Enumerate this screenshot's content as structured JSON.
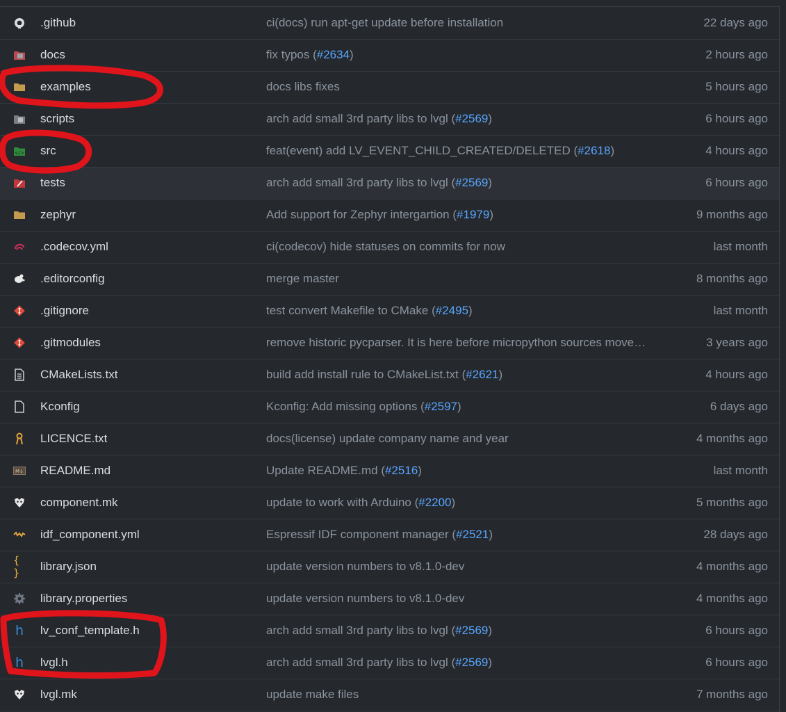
{
  "files": [
    {
      "name": ".github",
      "icon": "github-folder-icon",
      "commit": "ci(docs) run apt-get update before installation",
      "pr": "",
      "age": "22 days ago"
    },
    {
      "name": "docs",
      "icon": "docs-folder-icon",
      "commit": "fix typos (",
      "pr": "#2634",
      "commit_end": ")",
      "age": "2 hours ago"
    },
    {
      "name": "examples",
      "icon": "folder-icon",
      "commit": "docs libs fixes",
      "pr": "",
      "age": "5 hours ago"
    },
    {
      "name": "scripts",
      "icon": "scripts-folder-icon",
      "commit": "arch add small 3rd party libs to lvgl (",
      "pr": "#2569",
      "commit_end": ")",
      "age": "6 hours ago"
    },
    {
      "name": "src",
      "icon": "src-folder-icon",
      "commit": "feat(event) add LV_EVENT_CHILD_CREATED/DELETED (",
      "pr": "#2618",
      "commit_end": ")",
      "age": "4 hours ago"
    },
    {
      "name": "tests",
      "icon": "test-folder-icon",
      "commit": "arch add small 3rd party libs to lvgl (",
      "pr": "#2569",
      "commit_end": ")",
      "age": "6 hours ago"
    },
    {
      "name": "zephyr",
      "icon": "folder-icon",
      "commit": "Add support for Zephyr intergartion (",
      "pr": "#1979",
      "commit_end": ")",
      "age": "9 months ago"
    },
    {
      "name": ".codecov.yml",
      "icon": "codecov-icon",
      "commit": "ci(codecov) hide statuses on commits for now",
      "pr": "",
      "age": "last month"
    },
    {
      "name": ".editorconfig",
      "icon": "editorconfig-icon",
      "commit": "merge master",
      "pr": "",
      "age": "8 months ago"
    },
    {
      "name": ".gitignore",
      "icon": "git-icon",
      "commit": "test convert Makefile to CMake (",
      "pr": "#2495",
      "commit_end": ")",
      "age": "last month"
    },
    {
      "name": ".gitmodules",
      "icon": "git-icon",
      "commit": "remove historic pycparser. It is here before micropython sources move…",
      "pr": "",
      "age": "3 years ago"
    },
    {
      "name": "CMakeLists.txt",
      "icon": "text-file-icon",
      "commit": "build add install rule to CMakeList.txt (",
      "pr": "#2621",
      "commit_end": ")",
      "age": "4 hours ago"
    },
    {
      "name": "Kconfig",
      "icon": "file-icon",
      "commit": "Kconfig: Add missing options (",
      "pr": "#2597",
      "commit_end": ")",
      "age": "6 days ago"
    },
    {
      "name": "LICENCE.txt",
      "icon": "license-icon",
      "commit": "docs(license) update company name and year",
      "pr": "",
      "age": "4 months ago"
    },
    {
      "name": "README.md",
      "icon": "markdown-icon",
      "commit": "Update README.md (",
      "pr": "#2516",
      "commit_end": ")",
      "age": "last month"
    },
    {
      "name": "component.mk",
      "icon": "makefile-icon",
      "commit": "update to work with Arduino (",
      "pr": "#2200",
      "commit_end": ")",
      "age": "5 months ago"
    },
    {
      "name": "idf_component.yml",
      "icon": "yaml-icon",
      "commit": "Espressif IDF component manager (",
      "pr": "#2521",
      "commit_end": ")",
      "age": "28 days ago"
    },
    {
      "name": "library.json",
      "icon": "json-icon",
      "commit": "update version numbers to v8.1.0-dev",
      "pr": "",
      "age": "4 months ago"
    },
    {
      "name": "library.properties",
      "icon": "settings-gear-icon",
      "commit": "update version numbers to v8.1.0-dev",
      "pr": "",
      "age": "4 months ago"
    },
    {
      "name": "lv_conf_template.h",
      "icon": "h-header-icon",
      "commit": "arch add small 3rd party libs to lvgl (",
      "pr": "#2569",
      "commit_end": ")",
      "age": "6 hours ago"
    },
    {
      "name": "lvgl.h",
      "icon": "h-header-icon",
      "commit": "arch add small 3rd party libs to lvgl (",
      "pr": "#2569",
      "commit_end": ")",
      "age": "6 hours ago"
    },
    {
      "name": "lvgl.mk",
      "icon": "makefile-icon",
      "commit": "update make files",
      "pr": "",
      "age": "7 months ago"
    }
  ],
  "hover_row": 5,
  "colors": {
    "background": "#25282d",
    "pr_link": "#58a6ff",
    "annotation": "#e0141b"
  }
}
